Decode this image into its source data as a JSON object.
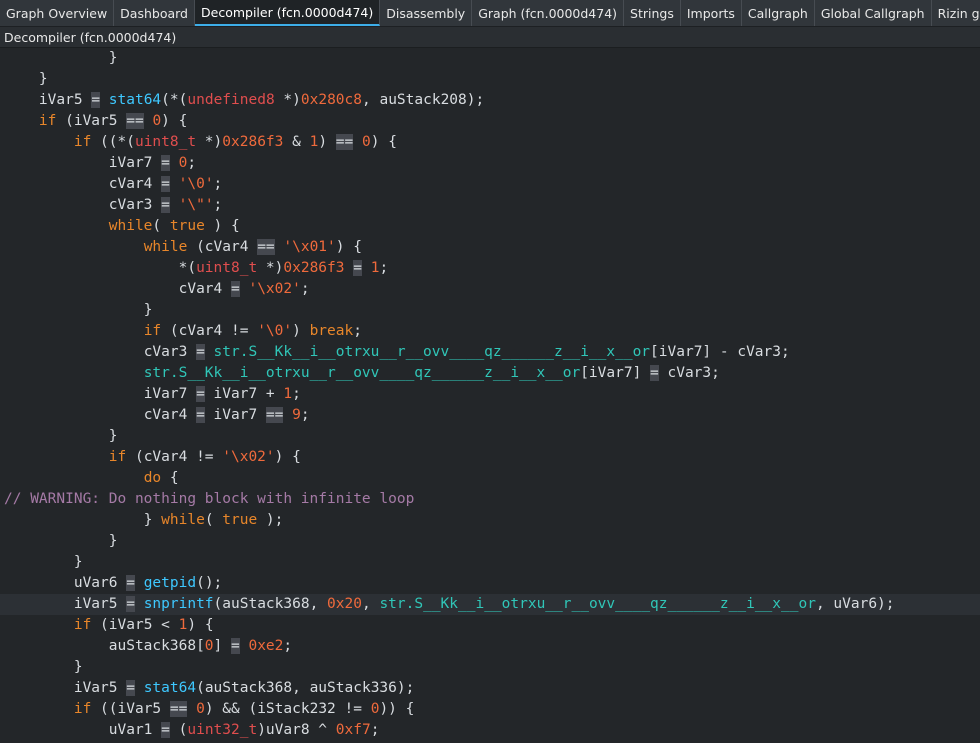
{
  "tabs": [
    {
      "label": "Graph Overview",
      "active": false
    },
    {
      "label": "Dashboard",
      "active": false
    },
    {
      "label": "Decompiler (fcn.0000d474)",
      "active": true
    },
    {
      "label": "Disassembly",
      "active": false
    },
    {
      "label": "Graph (fcn.0000d474)",
      "active": false
    },
    {
      "label": "Strings",
      "active": false
    },
    {
      "label": "Imports",
      "active": false
    },
    {
      "label": "Callgraph",
      "active": false
    },
    {
      "label": "Global Callgraph",
      "active": false
    },
    {
      "label": "Rizin graphs",
      "active": false
    }
  ],
  "panel_title": "Decompiler (fcn.0000d474)",
  "colors": {
    "accent": "#3daee9",
    "keyword": "#e8862a",
    "function": "#3ec8ff",
    "number": "#ef6a3c",
    "type": "#e04e4e",
    "symbol": "#30c6b8",
    "comment": "#a57aa6"
  },
  "code_lines": [
    {
      "indent": 3,
      "tokens": [
        [
          "p",
          "}"
        ]
      ]
    },
    {
      "indent": 1,
      "tokens": [
        [
          "p",
          "}"
        ]
      ]
    },
    {
      "indent": 1,
      "tokens": [
        [
          "p",
          "iVar5 "
        ],
        [
          "op",
          "="
        ],
        [
          "p",
          " "
        ],
        [
          "fn",
          "stat64"
        ],
        [
          "p",
          "(*("
        ],
        [
          "ty",
          "undefined8"
        ],
        [
          "p",
          " *)"
        ],
        [
          "num",
          "0x280c8"
        ],
        [
          "p",
          ", auStack208);"
        ]
      ]
    },
    {
      "indent": 1,
      "tokens": [
        [
          "kw",
          "if"
        ],
        [
          "p",
          " (iVar5 "
        ],
        [
          "op",
          "=="
        ],
        [
          "p",
          " "
        ],
        [
          "num",
          "0"
        ],
        [
          "p",
          ") {"
        ]
      ]
    },
    {
      "indent": 2,
      "tokens": [
        [
          "kw",
          "if"
        ],
        [
          "p",
          " ((*("
        ],
        [
          "ty",
          "uint8_t"
        ],
        [
          "p",
          " *)"
        ],
        [
          "num",
          "0x286f3"
        ],
        [
          "p",
          " & "
        ],
        [
          "num",
          "1"
        ],
        [
          "p",
          ") "
        ],
        [
          "op",
          "=="
        ],
        [
          "p",
          " "
        ],
        [
          "num",
          "0"
        ],
        [
          "p",
          ") {"
        ]
      ]
    },
    {
      "indent": 3,
      "tokens": [
        [
          "p",
          "iVar7 "
        ],
        [
          "op",
          "="
        ],
        [
          "p",
          " "
        ],
        [
          "num",
          "0"
        ],
        [
          "p",
          ";"
        ]
      ]
    },
    {
      "indent": 3,
      "tokens": [
        [
          "p",
          "cVar4 "
        ],
        [
          "op",
          "="
        ],
        [
          "p",
          " "
        ],
        [
          "st",
          "'\\0'"
        ],
        [
          "p",
          ";"
        ]
      ]
    },
    {
      "indent": 3,
      "tokens": [
        [
          "p",
          "cVar3 "
        ],
        [
          "op",
          "="
        ],
        [
          "p",
          " "
        ],
        [
          "st",
          "'\\\"'"
        ],
        [
          "p",
          ";"
        ]
      ]
    },
    {
      "indent": 3,
      "tokens": [
        [
          "kw",
          "while"
        ],
        [
          "p",
          "( "
        ],
        [
          "kw",
          "true"
        ],
        [
          "p",
          " ) {"
        ]
      ]
    },
    {
      "indent": 4,
      "tokens": [
        [
          "kw",
          "while"
        ],
        [
          "p",
          " (cVar4 "
        ],
        [
          "op",
          "=="
        ],
        [
          "p",
          " "
        ],
        [
          "st",
          "'\\x01'"
        ],
        [
          "p",
          ") {"
        ]
      ]
    },
    {
      "indent": 5,
      "tokens": [
        [
          "p",
          "*("
        ],
        [
          "ty",
          "uint8_t"
        ],
        [
          "p",
          " *)"
        ],
        [
          "num",
          "0x286f3"
        ],
        [
          "p",
          " "
        ],
        [
          "op",
          "="
        ],
        [
          "p",
          " "
        ],
        [
          "num",
          "1"
        ],
        [
          "p",
          ";"
        ]
      ]
    },
    {
      "indent": 5,
      "tokens": [
        [
          "p",
          "cVar4 "
        ],
        [
          "op",
          "="
        ],
        [
          "p",
          " "
        ],
        [
          "st",
          "'\\x02'"
        ],
        [
          "p",
          ";"
        ]
      ]
    },
    {
      "indent": 4,
      "tokens": [
        [
          "p",
          "}"
        ]
      ]
    },
    {
      "indent": 4,
      "tokens": [
        [
          "kw",
          "if"
        ],
        [
          "p",
          " (cVar4 != "
        ],
        [
          "st",
          "'\\0'"
        ],
        [
          "p",
          ") "
        ],
        [
          "kw",
          "break"
        ],
        [
          "p",
          ";"
        ]
      ]
    },
    {
      "indent": 4,
      "tokens": [
        [
          "p",
          "cVar3 "
        ],
        [
          "op",
          "="
        ],
        [
          "p",
          " "
        ],
        [
          "sy",
          "str.S__Kk__i__otrxu__r__ovv____qz______z__i__x__or"
        ],
        [
          "p",
          "[iVar7] - cVar3;"
        ]
      ]
    },
    {
      "indent": 4,
      "tokens": [
        [
          "sy",
          "str.S__Kk__i__otrxu__r__ovv____qz______z__i__x__or"
        ],
        [
          "p",
          "[iVar7] "
        ],
        [
          "op",
          "="
        ],
        [
          "p",
          " cVar3;"
        ]
      ]
    },
    {
      "indent": 4,
      "tokens": [
        [
          "p",
          "iVar7 "
        ],
        [
          "op",
          "="
        ],
        [
          "p",
          " iVar7 + "
        ],
        [
          "num",
          "1"
        ],
        [
          "p",
          ";"
        ]
      ]
    },
    {
      "indent": 4,
      "tokens": [
        [
          "p",
          "cVar4 "
        ],
        [
          "op",
          "="
        ],
        [
          "p",
          " iVar7 "
        ],
        [
          "op",
          "=="
        ],
        [
          "p",
          " "
        ],
        [
          "num",
          "9"
        ],
        [
          "p",
          ";"
        ]
      ]
    },
    {
      "indent": 3,
      "tokens": [
        [
          "p",
          "}"
        ]
      ]
    },
    {
      "indent": 3,
      "tokens": [
        [
          "kw",
          "if"
        ],
        [
          "p",
          " (cVar4 != "
        ],
        [
          "st",
          "'\\x02'"
        ],
        [
          "p",
          ") {"
        ]
      ]
    },
    {
      "indent": 4,
      "tokens": [
        [
          "kw",
          "do"
        ],
        [
          "p",
          " {"
        ]
      ]
    },
    {
      "indent": 0,
      "tokens": [
        [
          "cm",
          "// WARNING: Do nothing block with infinite loop"
        ]
      ]
    },
    {
      "indent": 4,
      "tokens": [
        [
          "p",
          "} "
        ],
        [
          "kw",
          "while"
        ],
        [
          "p",
          "( "
        ],
        [
          "kw",
          "true"
        ],
        [
          "p",
          " );"
        ]
      ]
    },
    {
      "indent": 3,
      "tokens": [
        [
          "p",
          "}"
        ]
      ]
    },
    {
      "indent": 2,
      "tokens": [
        [
          "p",
          "}"
        ]
      ]
    },
    {
      "indent": 2,
      "tokens": [
        [
          "p",
          "uVar6 "
        ],
        [
          "op",
          "="
        ],
        [
          "p",
          " "
        ],
        [
          "fn",
          "getpid"
        ],
        [
          "p",
          "();"
        ]
      ]
    },
    {
      "indent": 2,
      "current": true,
      "tokens": [
        [
          "p",
          "iVar5 "
        ],
        [
          "op",
          "="
        ],
        [
          "p",
          " "
        ],
        [
          "fn",
          "snprintf"
        ],
        [
          "p",
          "(auStack368, "
        ],
        [
          "num",
          "0x20"
        ],
        [
          "p",
          ", "
        ],
        [
          "sy",
          "str.S__Kk__i__otrxu__r__ovv____qz______z__i__x__or"
        ],
        [
          "p",
          ", uVar6);"
        ]
      ]
    },
    {
      "indent": 2,
      "tokens": [
        [
          "kw",
          "if"
        ],
        [
          "p",
          " (iVar5 < "
        ],
        [
          "num",
          "1"
        ],
        [
          "p",
          ") {"
        ]
      ]
    },
    {
      "indent": 3,
      "tokens": [
        [
          "p",
          "auStack368["
        ],
        [
          "num",
          "0"
        ],
        [
          "p",
          "] "
        ],
        [
          "op",
          "="
        ],
        [
          "p",
          " "
        ],
        [
          "num",
          "0xe2"
        ],
        [
          "p",
          ";"
        ]
      ]
    },
    {
      "indent": 2,
      "tokens": [
        [
          "p",
          "}"
        ]
      ]
    },
    {
      "indent": 2,
      "tokens": [
        [
          "p",
          "iVar5 "
        ],
        [
          "op",
          "="
        ],
        [
          "p",
          " "
        ],
        [
          "fn",
          "stat64"
        ],
        [
          "p",
          "(auStack368, auStack336);"
        ]
      ]
    },
    {
      "indent": 2,
      "tokens": [
        [
          "kw",
          "if"
        ],
        [
          "p",
          " ((iVar5 "
        ],
        [
          "op",
          "=="
        ],
        [
          "p",
          " "
        ],
        [
          "num",
          "0"
        ],
        [
          "p",
          ") && (iStack232 != "
        ],
        [
          "num",
          "0"
        ],
        [
          "p",
          ")) {"
        ]
      ]
    },
    {
      "indent": 3,
      "tokens": [
        [
          "p",
          "uVar1 "
        ],
        [
          "op",
          "="
        ],
        [
          "p",
          " ("
        ],
        [
          "ty",
          "uint32_t"
        ],
        [
          "p",
          ")uVar8 ^ "
        ],
        [
          "num",
          "0xf7"
        ],
        [
          "p",
          ";"
        ]
      ]
    }
  ]
}
